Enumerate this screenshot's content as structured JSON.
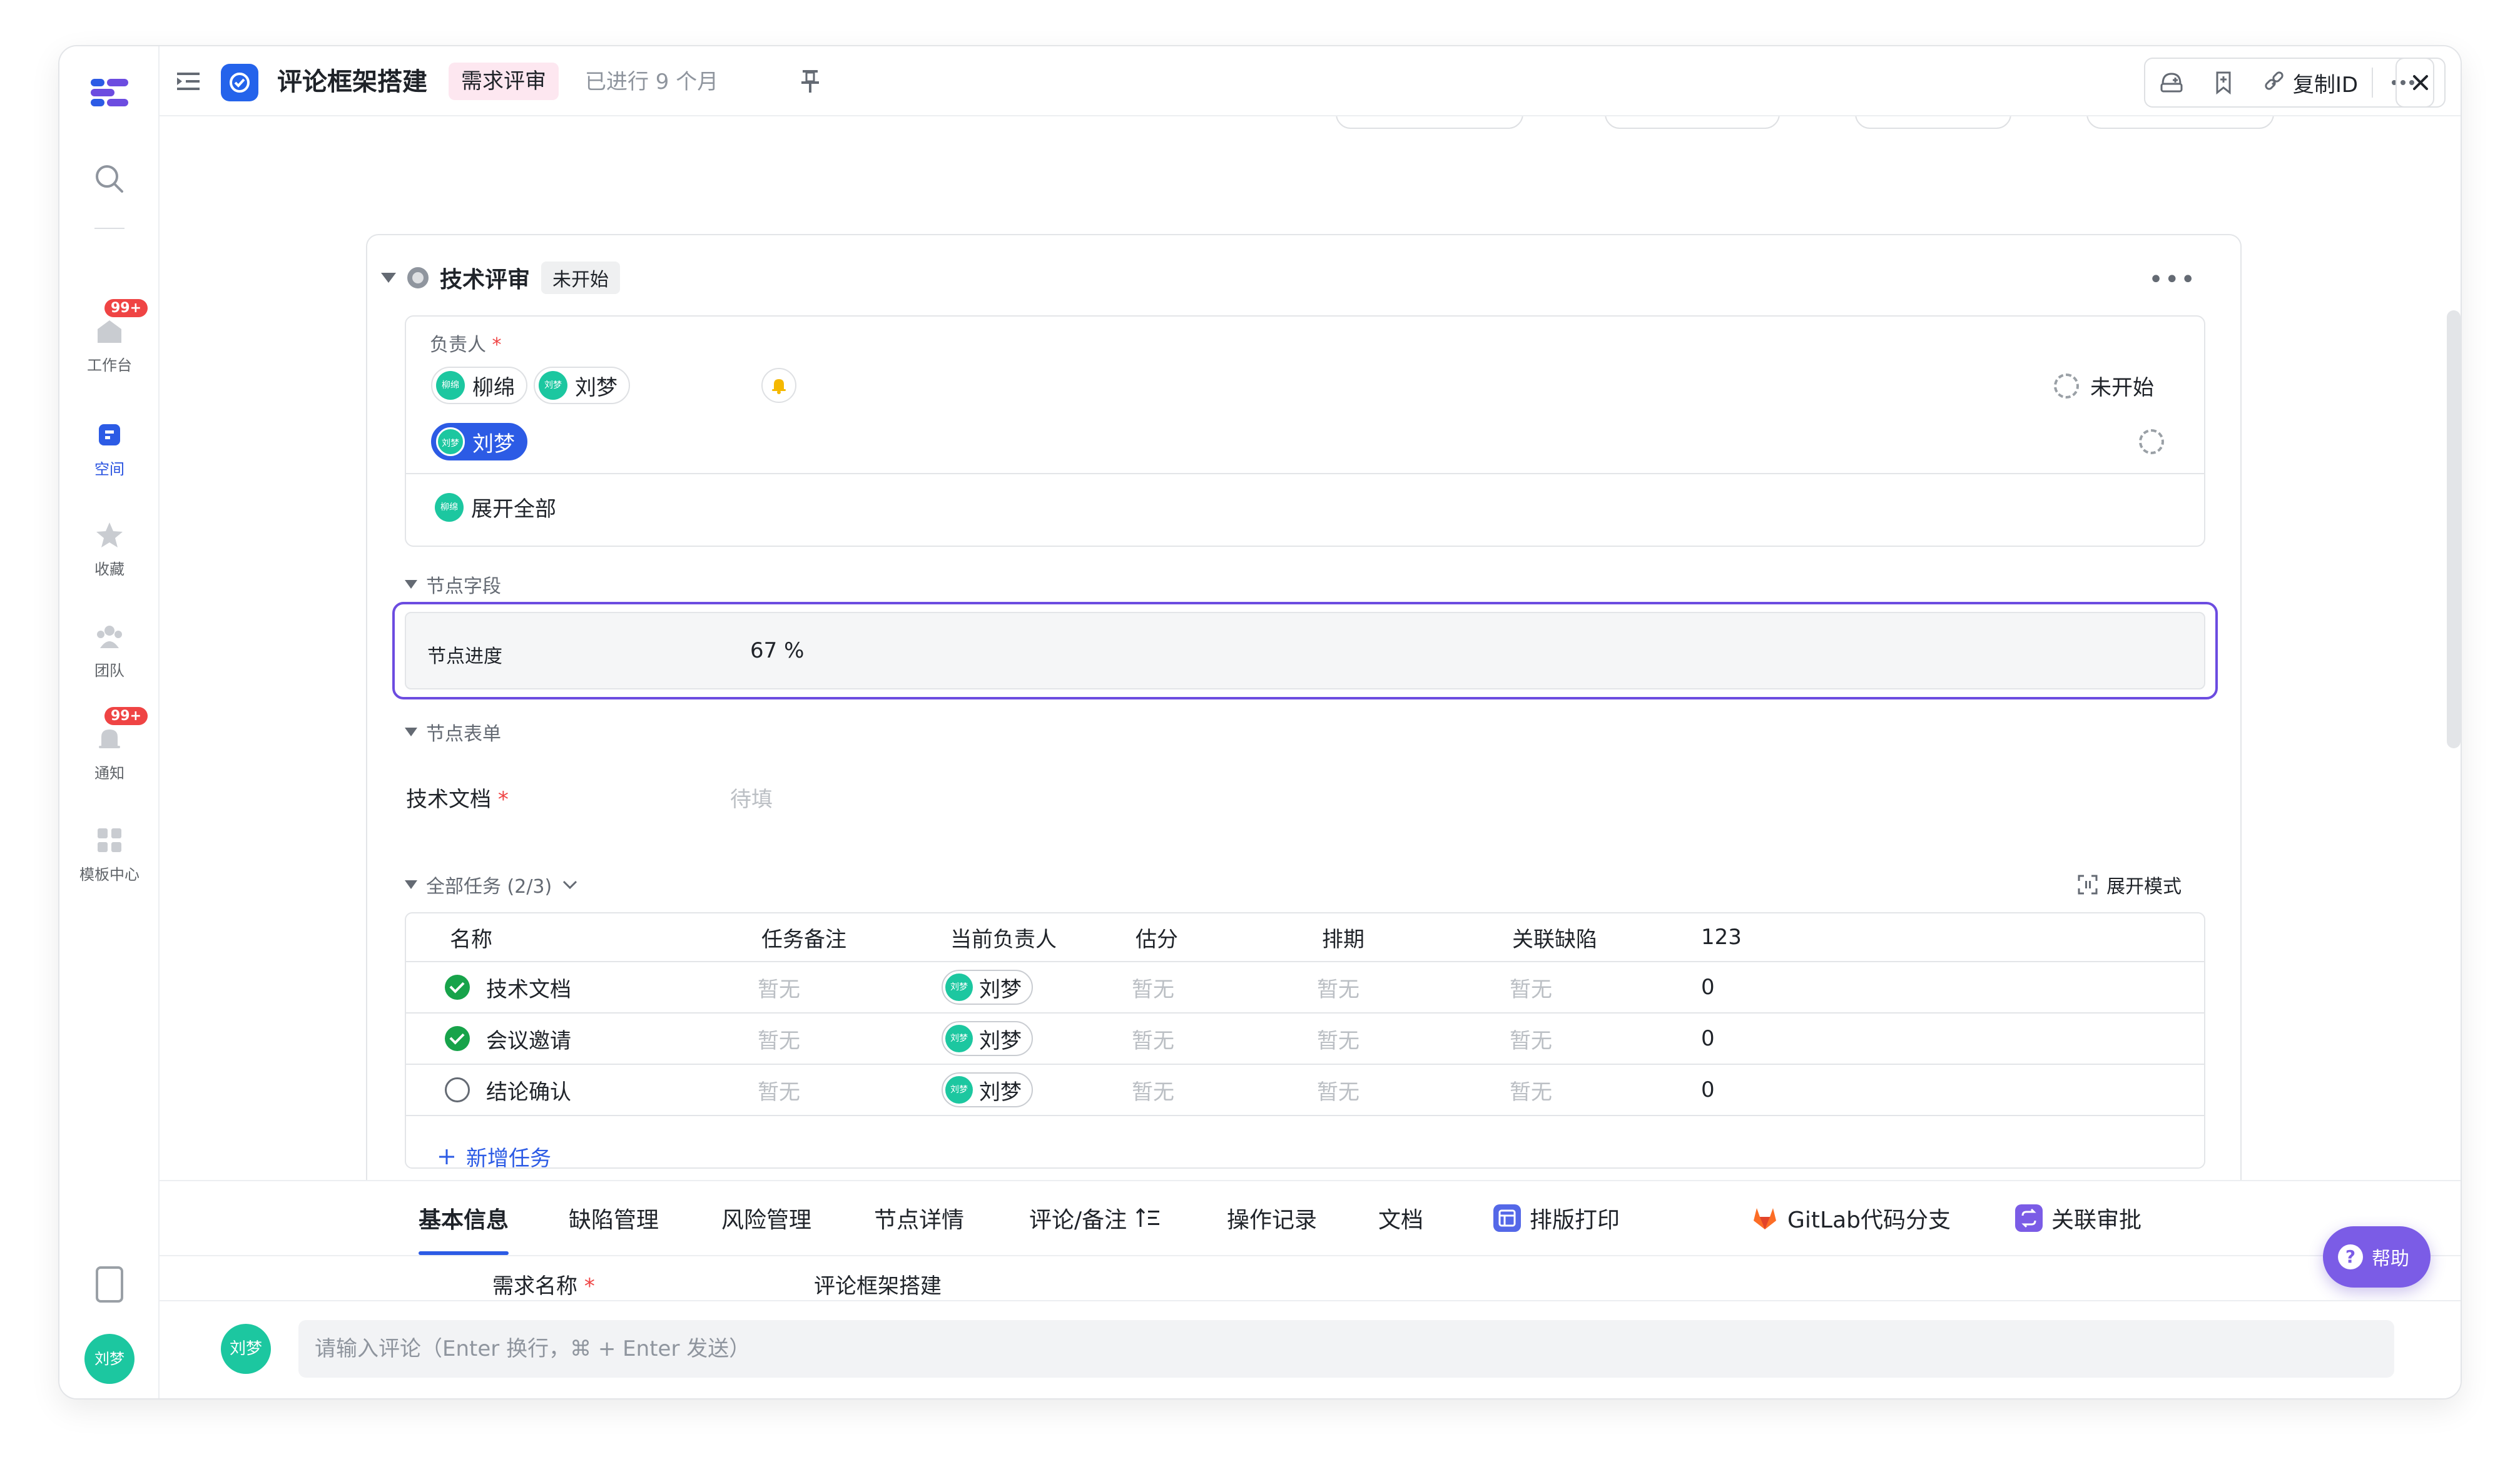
{
  "sidebar": {
    "items": [
      {
        "label": "工作台",
        "badge": "99+"
      },
      {
        "label": "空间"
      },
      {
        "label": "收藏"
      },
      {
        "label": "团队"
      },
      {
        "label": "通知",
        "badge": "99+"
      },
      {
        "label": "模板中心"
      }
    ],
    "avatar": "刘梦"
  },
  "topbar": {
    "title": "评论框架搭建",
    "tag": "需求评审",
    "progress": "已进行 9 个月",
    "copy_id": "复制ID"
  },
  "stage": {
    "name": "技术评审",
    "status": "未开始",
    "owner_label": "负责人",
    "owners": [
      {
        "name": "柳绵",
        "avatar": "柳绵"
      },
      {
        "name": "刘梦",
        "avatar": "刘梦"
      }
    ],
    "selected_owner": {
      "name": "刘梦",
      "avatar": "刘梦"
    },
    "owner_status": "未开始",
    "expand_all": "展开全部",
    "expand_avatar": "柳绵"
  },
  "node_fields": {
    "title": "节点字段",
    "progress_label": "节点进度",
    "progress_value": "67 %"
  },
  "node_form": {
    "title": "节点表单",
    "field_label": "技术文档",
    "field_value": "待填"
  },
  "tasks": {
    "title": "全部任务 (2/3)",
    "view_mode": "展开模式",
    "columns": [
      "名称",
      "任务备注",
      "当前负责人",
      "估分",
      "排期",
      "关联缺陷",
      "123"
    ],
    "rows": [
      {
        "name": "技术文档",
        "done": true,
        "note": "暂无",
        "owner": "刘梦",
        "owner_avatar": "刘梦",
        "estimate": "暂无",
        "schedule": "暂无",
        "defects": "暂无",
        "extra": "0"
      },
      {
        "name": "会议邀请",
        "done": true,
        "note": "暂无",
        "owner": "刘梦",
        "owner_avatar": "刘梦",
        "estimate": "暂无",
        "schedule": "暂无",
        "defects": "暂无",
        "extra": "0"
      },
      {
        "name": "结论确认",
        "done": false,
        "note": "暂无",
        "owner": "刘梦",
        "owner_avatar": "刘梦",
        "estimate": "暂无",
        "schedule": "暂无",
        "defects": "暂无",
        "extra": "0"
      }
    ],
    "add_label": "新增任务"
  },
  "tabs": [
    "基本信息",
    "缺陷管理",
    "风险管理",
    "节点详情",
    "评论/备注",
    "操作记录",
    "文档",
    "排版打印",
    "GitLab代码分支",
    "关联审批"
  ],
  "basic_info": {
    "label": "需求名称",
    "value": "评论框架搭建"
  },
  "comment": {
    "avatar": "刘梦",
    "placeholder": "请输入评论（Enter 换行，⌘ + Enter 发送）"
  },
  "help": {
    "label": "帮助"
  },
  "colors": {
    "accent": "#2c5be5",
    "focus": "#6c4ce0",
    "done": "#17a34a",
    "avatar": "#1cc7a0",
    "badge": "#ef4444",
    "help": "#7b5ce6",
    "tag_bg": "#fde7f0"
  }
}
